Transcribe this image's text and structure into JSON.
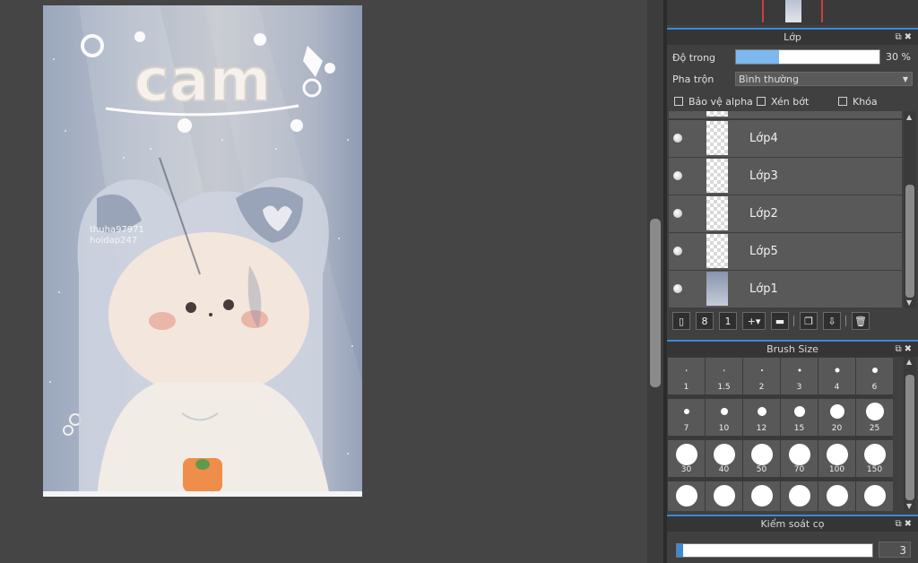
{
  "artwork": {
    "title_text": "cam",
    "watermark_line1": "thuha97971",
    "watermark_line2": "hoidap247"
  },
  "layer_panel": {
    "title": "Lớp",
    "opacity_label": "Độ trong",
    "opacity_value": "30 %",
    "opacity_fraction": 0.3,
    "blend_label": "Pha trộn",
    "blend_value": "Bình thường",
    "checkboxes": {
      "protect_alpha": "Bảo vệ alpha",
      "clipping": "Xén bớt",
      "lock": "Khóa"
    },
    "layers": [
      {
        "name": "Lớp4",
        "thumb": "transparent"
      },
      {
        "name": "Lớp3",
        "thumb": "transparent"
      },
      {
        "name": "Lớp2",
        "thumb": "transparent"
      },
      {
        "name": "Lớp5",
        "thumb": "transparent"
      },
      {
        "name": "Lớp1",
        "thumb": "image"
      }
    ]
  },
  "brush_size_panel": {
    "title": "Brush Size",
    "sizes": [
      "1",
      "1.5",
      "2",
      "3",
      "4",
      "6",
      "7",
      "10",
      "12",
      "15",
      "20",
      "25",
      "30",
      "40",
      "50",
      "70",
      "100",
      "150"
    ]
  },
  "brush_control_panel": {
    "title": "Kiểm soát cọ",
    "value": "3",
    "fraction": 0.03
  },
  "colors": {
    "accent": "#3a8ad6",
    "opacity_fill": "#7db8ef",
    "nav_frame": "#d23b3b"
  },
  "icons": {
    "panel_header": [
      "restore-icon",
      "close-icon"
    ],
    "layer_toolbar": [
      "new-layer-icon",
      "new-layer-8bit-icon",
      "new-layer-1bit-icon",
      "add-layer-menu-icon",
      "folder-icon",
      "duplicate-layer-icon",
      "merge-layer-icon",
      "trash-icon"
    ]
  }
}
